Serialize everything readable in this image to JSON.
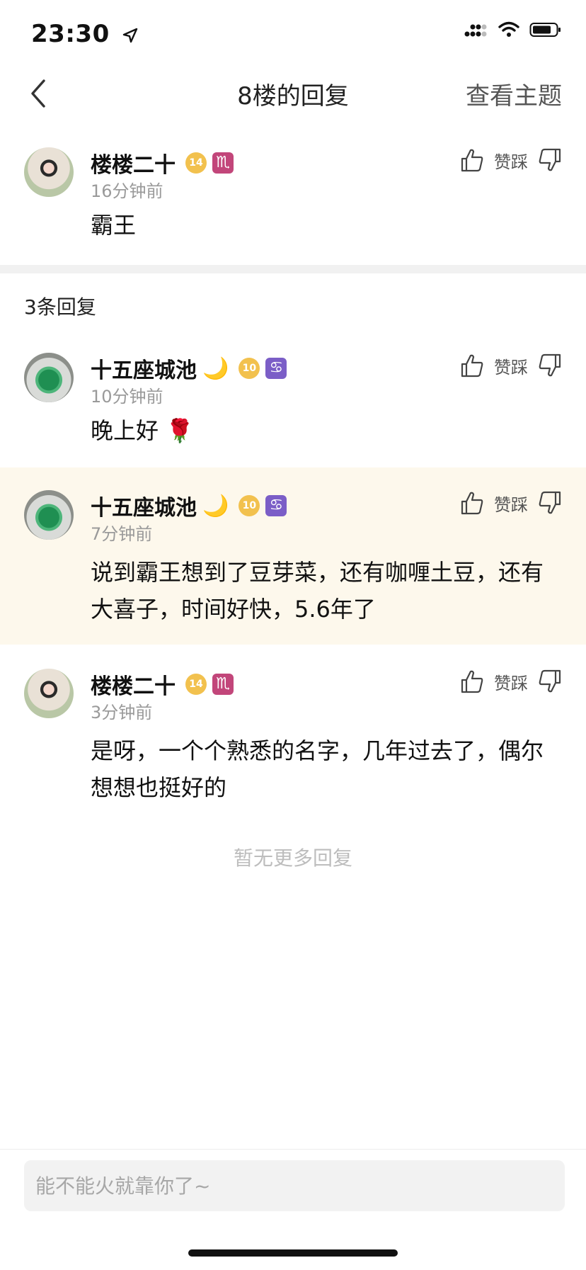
{
  "status": {
    "time": "23:30"
  },
  "nav": {
    "title": "8楼的回复",
    "right": "查看主题"
  },
  "main_comment": {
    "user": "楼楼二十",
    "level": "14",
    "zodiac": "♏",
    "time": "16分钟前",
    "text": "霸王",
    "action_label": "赞踩"
  },
  "replies_count": "3条回复",
  "replies": [
    {
      "user": "十五座城池",
      "level": "10",
      "zodiac": "♋",
      "time": "10分钟前",
      "text": "晚上好 🌹",
      "action_label": "赞踩"
    },
    {
      "user": "十五座城池",
      "level": "10",
      "zodiac": "♋",
      "time": "7分钟前",
      "text": "说到霸王想到了豆芽菜，还有咖喱土豆，还有大喜子，时间好快，5.6年了",
      "action_label": "赞踩"
    },
    {
      "user": "楼楼二十",
      "level": "14",
      "zodiac": "♏",
      "time": "3分钟前",
      "text": "是呀，一个个熟悉的名字，几年过去了，偶尔想想也挺好的",
      "action_label": "赞踩"
    }
  ],
  "no_more": "暂无更多回复",
  "input": {
    "placeholder": "能不能火就靠你了~"
  },
  "colors": {
    "highlight_bg": "#fdf8ec",
    "level_badge": "#f2c14e",
    "scorpio": "#c2467a",
    "cancer": "#7b5ec7"
  }
}
